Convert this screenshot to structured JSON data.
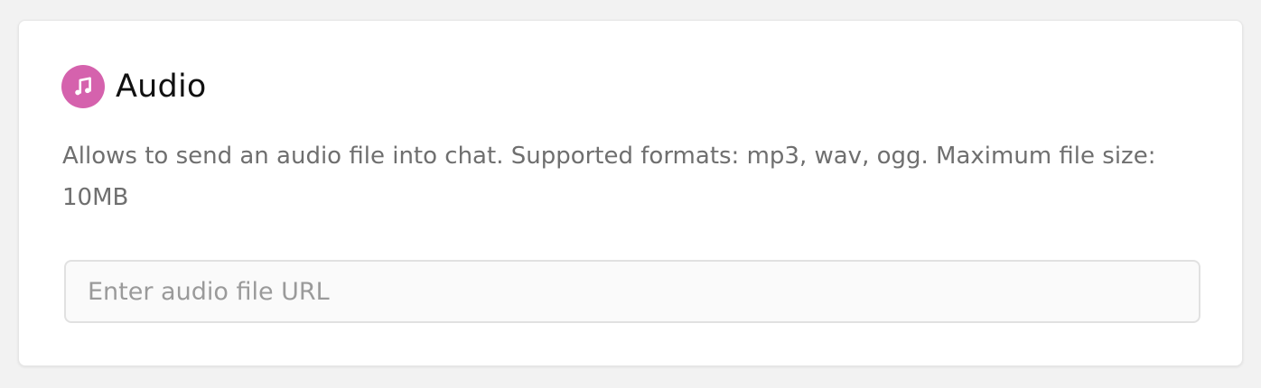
{
  "widget": {
    "title": "Audio",
    "icon": "music-note-icon",
    "icon_color": "#d562ad",
    "description": "Allows to send an audio file into chat. Supported formats: mp3, wav, ogg. Maximum file size: 10MB",
    "url_input": {
      "value": "",
      "placeholder": "Enter audio file URL"
    }
  }
}
